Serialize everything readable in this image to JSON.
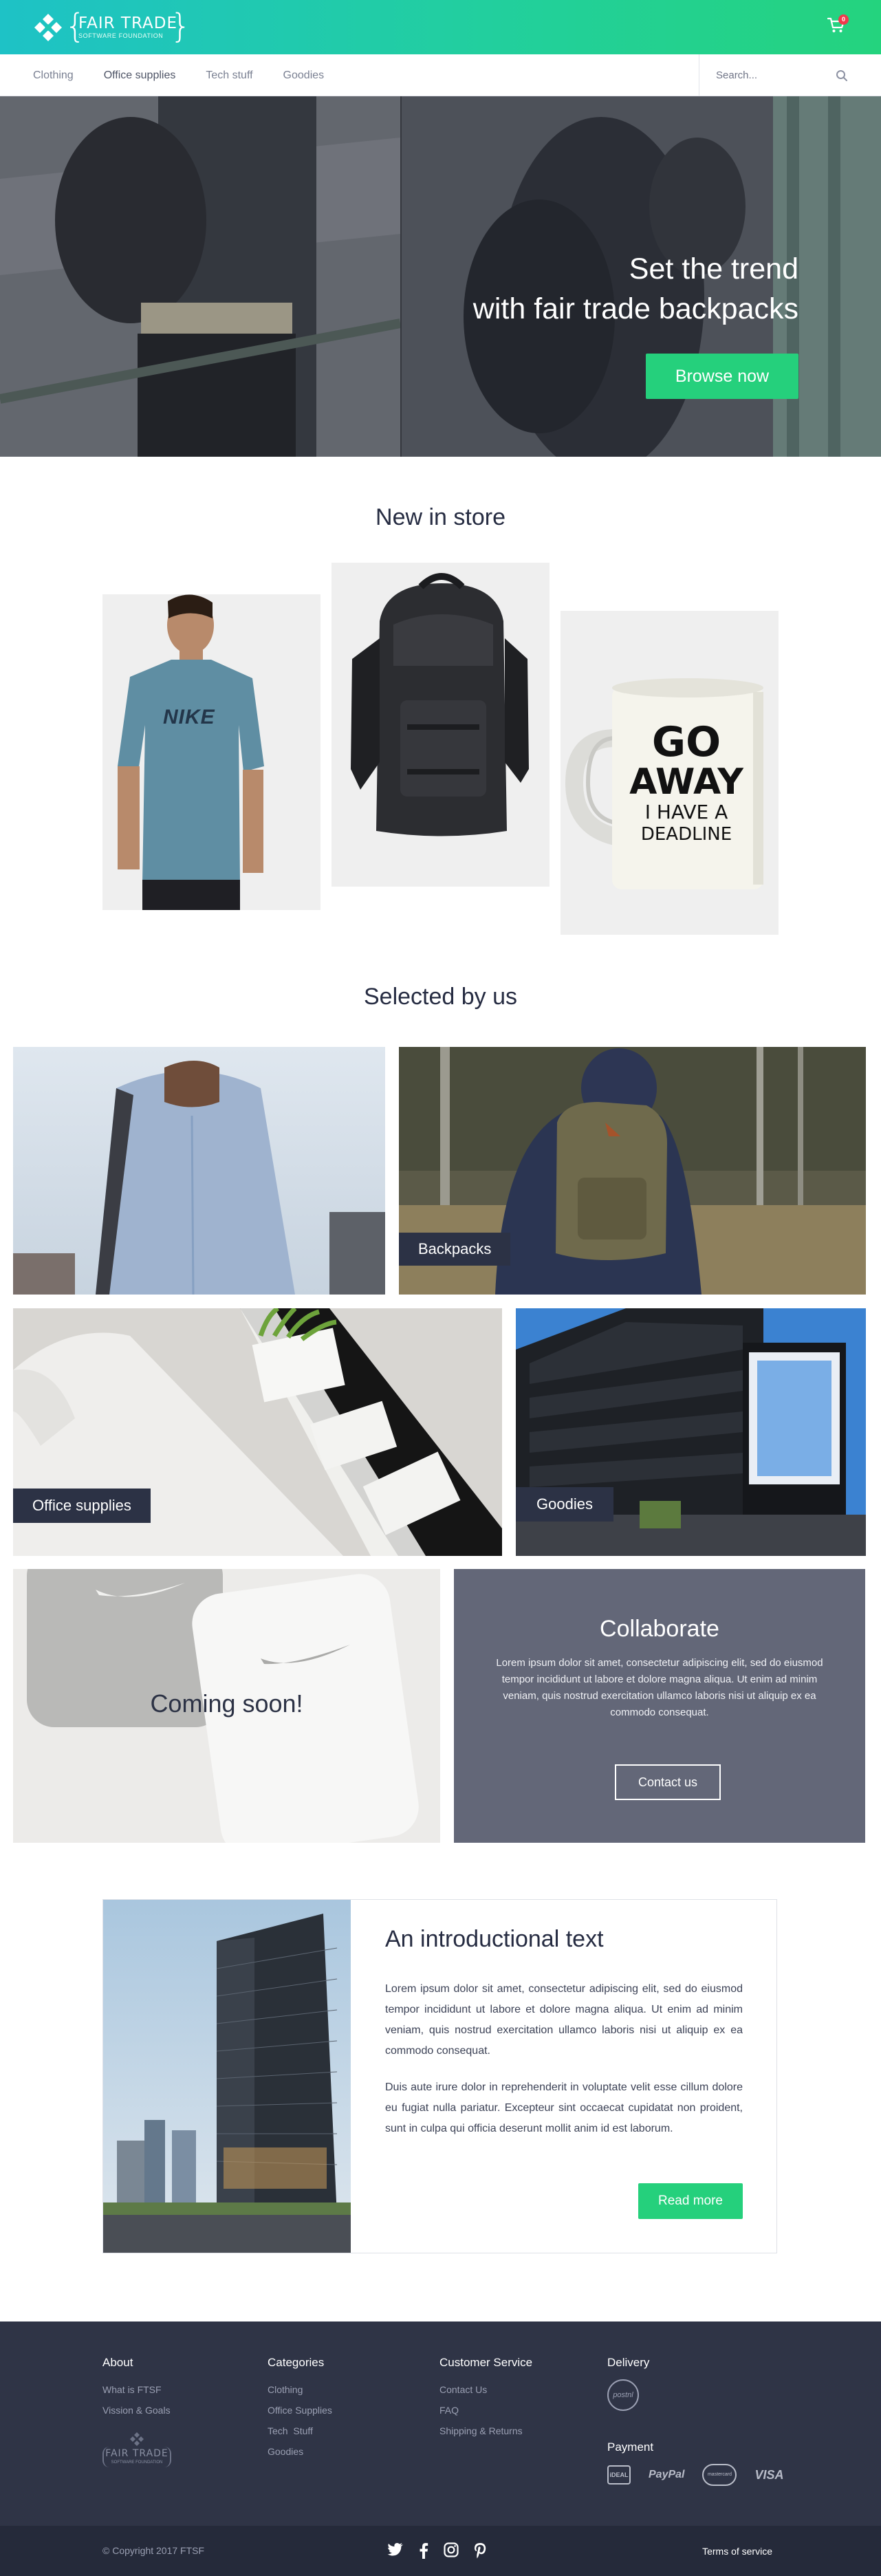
{
  "colors": {
    "brand_gradient_start": "#1ec2c6",
    "brand_gradient_end": "#24d37e",
    "accent_green": "#25d07c",
    "dark_navy": "#2c3245",
    "footer_bg": "#2f3446",
    "cart_badge": "#f0394d"
  },
  "header": {
    "logo_title": "FAIR TRADE",
    "logo_subtitle": "SOFTWARE FOUNDATION",
    "cart_icon": "shopping-cart-icon",
    "cart_count": "0"
  },
  "nav": {
    "items": [
      {
        "label": "Clothing"
      },
      {
        "label": "Office supplies"
      },
      {
        "label": "Tech stuff"
      },
      {
        "label": "Goodies"
      }
    ],
    "search_placeholder": "Search...",
    "search_icon": "search-icon"
  },
  "hero": {
    "title_line1": "Set the trend",
    "title_line2": "with fair trade backpacks",
    "button_label": "Browse now"
  },
  "new_in_store": {
    "title": "New in store",
    "products": [
      {
        "name": "T-shirt",
        "print": "NIKE"
      },
      {
        "name": "Backpack"
      },
      {
        "name": "Mug",
        "print_line1": "GO",
        "print_line2": "AWAY",
        "print_line3": "I HAVE A",
        "print_line4": "DEADLINE"
      }
    ]
  },
  "selected_by_us": {
    "title": "Selected by us",
    "tiles": [
      {
        "label": "Backpacks"
      },
      {
        "label": "Office supplies"
      },
      {
        "label": "Goodies"
      }
    ],
    "coming_soon": "Coming soon!",
    "collaborate": {
      "title": "Collaborate",
      "body": "Lorem ipsum dolor sit amet, consectetur adipiscing elit, sed do eiusmod tempor incididunt ut labore et dolore magna aliqua. Ut enim ad minim veniam, quis nostrud exercitation ullamco laboris nisi ut aliquip ex ea commodo consequat.",
      "button_label": "Contact us"
    }
  },
  "intro": {
    "title": "An introductional text",
    "paragraph1": "Lorem ipsum dolor sit amet, consectetur adipiscing elit, sed do eiusmod tempor incididunt ut labore et dolore magna aliqua. Ut enim ad minim veniam, quis nostrud exercitation ullamco laboris nisi ut aliquip ex ea commodo consequat.",
    "paragraph2": "Duis aute irure dolor in reprehenderit in voluptate velit esse cillum dolore eu fugiat nulla pariatur. Excepteur sint occaecat cupidatat non proident, sunt in culpa qui officia deserunt mollit anim id est laborum.",
    "button_label": "Read more"
  },
  "footer": {
    "about": {
      "heading": "About",
      "links": [
        "What is FTSF",
        "Vission & Goals"
      ]
    },
    "categories": {
      "heading": "Categories",
      "links": [
        "Clothing",
        "Office Supplies",
        "Tech  Stuff",
        "Goodies"
      ]
    },
    "customer_service": {
      "heading": "Customer Service",
      "links": [
        "Contact Us",
        "FAQ",
        "Shipping & Returns"
      ]
    },
    "delivery": {
      "heading": "Delivery",
      "carrier_badge": "postnl"
    },
    "payment": {
      "heading": "Payment",
      "methods": [
        "iDEAL",
        "PayPal",
        "mastercard",
        "VISA"
      ]
    },
    "logo_title": "FAIR TRADE",
    "logo_subtitle": "SOFTWARE FOUNDATION",
    "copyright": "© Copyright 2017 FTSF",
    "social_icons": [
      "twitter-icon",
      "facebook-icon",
      "instagram-icon",
      "pinterest-icon"
    ],
    "terms": "Terms of service"
  }
}
